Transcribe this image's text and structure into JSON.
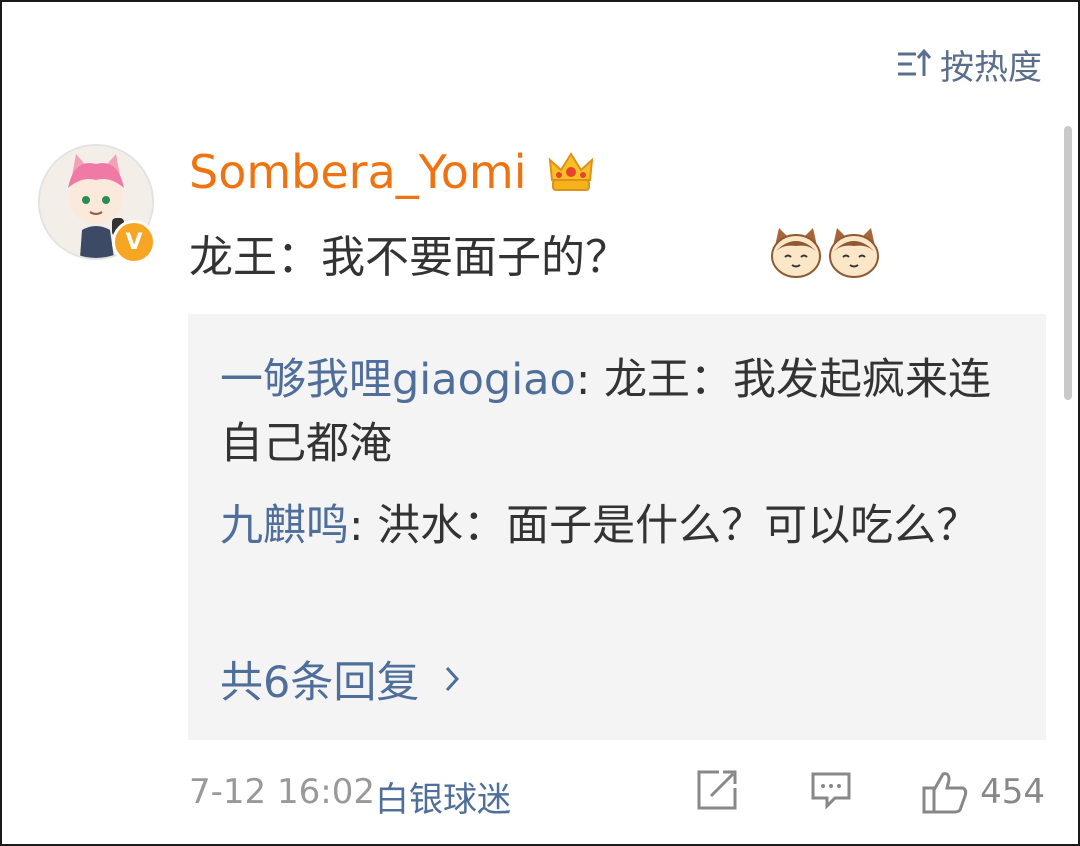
{
  "sort": {
    "label": "按热度",
    "icon": "sort-icon"
  },
  "comment": {
    "username": "Sombera_Yomi",
    "username_color": "#ef7411",
    "badge_icon": "crown-icon",
    "verified_badge": "V",
    "text": "龙王：我不要面子的？",
    "emojis": [
      "cat-emoji",
      "cat-emoji"
    ],
    "timestamp": "7-12 16:02",
    "source": "白银球迷",
    "likes": "454"
  },
  "replies": [
    {
      "author": "一够我哩giaogiao",
      "separator": ": ",
      "text": "龙王：我发起疯来连自己都淹"
    },
    {
      "author": "九麒鸣",
      "separator": ": ",
      "text": "洪水：面子是什么？可以吃么？"
    }
  ],
  "more_replies": {
    "label": "共6条回复"
  },
  "colors": {
    "link": "#4f6f9a",
    "text": "#333333",
    "muted": "#999999",
    "reply_bg": "#f4f4f4"
  }
}
